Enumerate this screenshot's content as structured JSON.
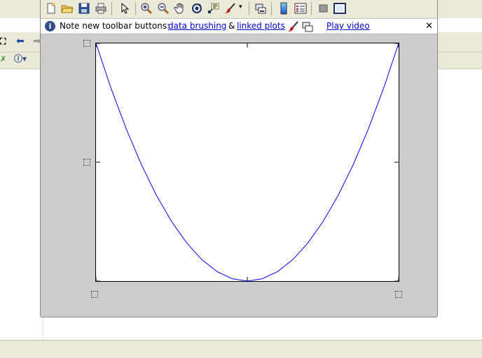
{
  "notebar": {
    "prefix": "Note new toolbar buttons:",
    "link_brushing": "data brushing",
    "ampersand": "&",
    "link_linked": "linked plots",
    "link_video": "Play video",
    "close_glyph": "✕"
  },
  "toolbar": {
    "buttons": [
      "new-figure",
      "open-file",
      "save",
      "print",
      "edit-plot",
      "zoom-in",
      "zoom-out",
      "pan",
      "rotate-3d",
      "data-cursor",
      "brush",
      "brush-dropdown",
      "link-plot",
      "colorbar",
      "legend",
      "hide-plot-tools",
      "show-plot-tools"
    ]
  },
  "chart_data": {
    "type": "line",
    "title": "",
    "xlabel": "",
    "ylabel": "",
    "x": [
      -1,
      -0.9,
      -0.8,
      -0.7,
      -0.6,
      -0.5,
      -0.4,
      -0.3,
      -0.2,
      -0.1,
      0,
      0.1,
      0.2,
      0.3,
      0.4,
      0.5,
      0.6,
      0.7,
      0.8,
      0.9,
      1
    ],
    "series": [
      {
        "values": [
          1,
          0.81,
          0.64,
          0.49,
          0.36,
          0.25,
          0.16,
          0.09,
          0.04,
          0.01,
          0,
          0.01,
          0.04,
          0.09,
          0.16,
          0.25,
          0.36,
          0.49,
          0.64,
          0.81,
          1
        ],
        "color": "#0000ff"
      }
    ],
    "xlim": [
      -1,
      1
    ],
    "ylim": [
      0,
      1
    ],
    "x_ticks": [
      -1,
      0,
      1
    ],
    "y_ticks": [
      0,
      0.5,
      1
    ],
    "tick_labels_shown": false,
    "grid": false
  },
  "colors": {
    "line": "#0000ff",
    "figure_bg": "#cccccc",
    "toolbar_bg": "#ece9d8",
    "link": "#0000cc"
  }
}
